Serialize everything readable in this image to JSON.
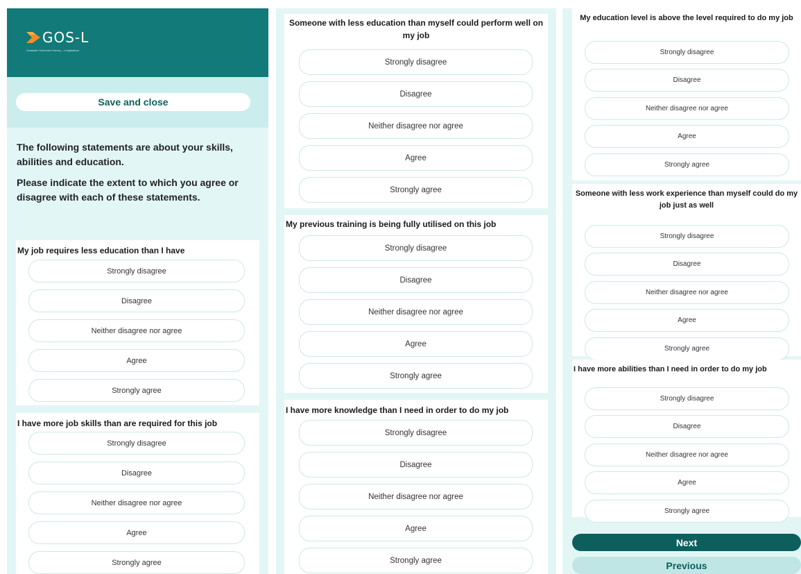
{
  "brand": {
    "logo_text": "GOS-L",
    "logo_subtitle": "Graduate Outcomes Survey – Longitudinal",
    "accent": "#127a78"
  },
  "header": {
    "save_label": "Save and close"
  },
  "intro": {
    "line1": "The following statements are about your skills, abilities and education.",
    "line2": "Please indicate the extent to which you agree or disagree with each of these statements."
  },
  "options": [
    "Strongly disagree",
    "Disagree",
    "Neither disagree nor agree",
    "Agree",
    "Strongly agree"
  ],
  "questions": [
    {
      "title": "My job requires less education than I have"
    },
    {
      "title": "I have more job skills than are required for this job"
    },
    {
      "title": "Someone with less education than myself could perform well on my job"
    },
    {
      "title": "My previous training is being fully utilised on this job"
    },
    {
      "title": "I have more knowledge than I need in order to do my job"
    },
    {
      "title": "My education level is above the level required to do my job"
    },
    {
      "title": "Someone with less work experience than myself could do my job just as well"
    },
    {
      "title": "I have more abilities than I need in order to do my job"
    }
  ],
  "nav": {
    "next_label": "Next",
    "previous_label": "Previous"
  }
}
